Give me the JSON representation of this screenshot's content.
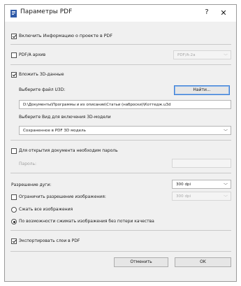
{
  "window": {
    "title": "Параметры PDF",
    "help_glyph": "?",
    "close_glyph": "✕"
  },
  "project_info": {
    "label": "Включить Информацию о проекте в PDF",
    "checked": true
  },
  "pdfa": {
    "label": "PDF/A архив",
    "checked": false,
    "select_value": "PDF/A-2a"
  },
  "embed_3d": {
    "label": "Вложить 3D-данные",
    "checked": true,
    "file_label": "Выберите файл U3D:",
    "find_button": "Найти...",
    "file_path": "D:\\Документы\\Программы и их описание\\Статьи (наброски)\\Коттедж.u3d",
    "view_label": "Выберите Вид для включения 3D-модели",
    "view_value": "Сохраненное в PDF 3D модель"
  },
  "password": {
    "label": "Для открытия документа необходим пароль",
    "checked": false,
    "field_label": "Пароль:",
    "field_value": ""
  },
  "arc": {
    "label": "Разрешение дуги:",
    "value": "300 dpi"
  },
  "limit_res": {
    "label": "Ограничить разрешение изображения:",
    "checked": false,
    "value": "300 dpi"
  },
  "compress": {
    "option_all": "Сжать все изображения",
    "option_lossless": "По возможности сжимать изображения без потери качества",
    "selected": "option_lossless"
  },
  "layers": {
    "label": "Экспортировать слои в PDF",
    "checked": true
  },
  "buttons": {
    "cancel": "Отменить",
    "ok": "OK"
  },
  "colors": {
    "accent": "#3c7fd6",
    "icon": "#2f5aa8"
  }
}
